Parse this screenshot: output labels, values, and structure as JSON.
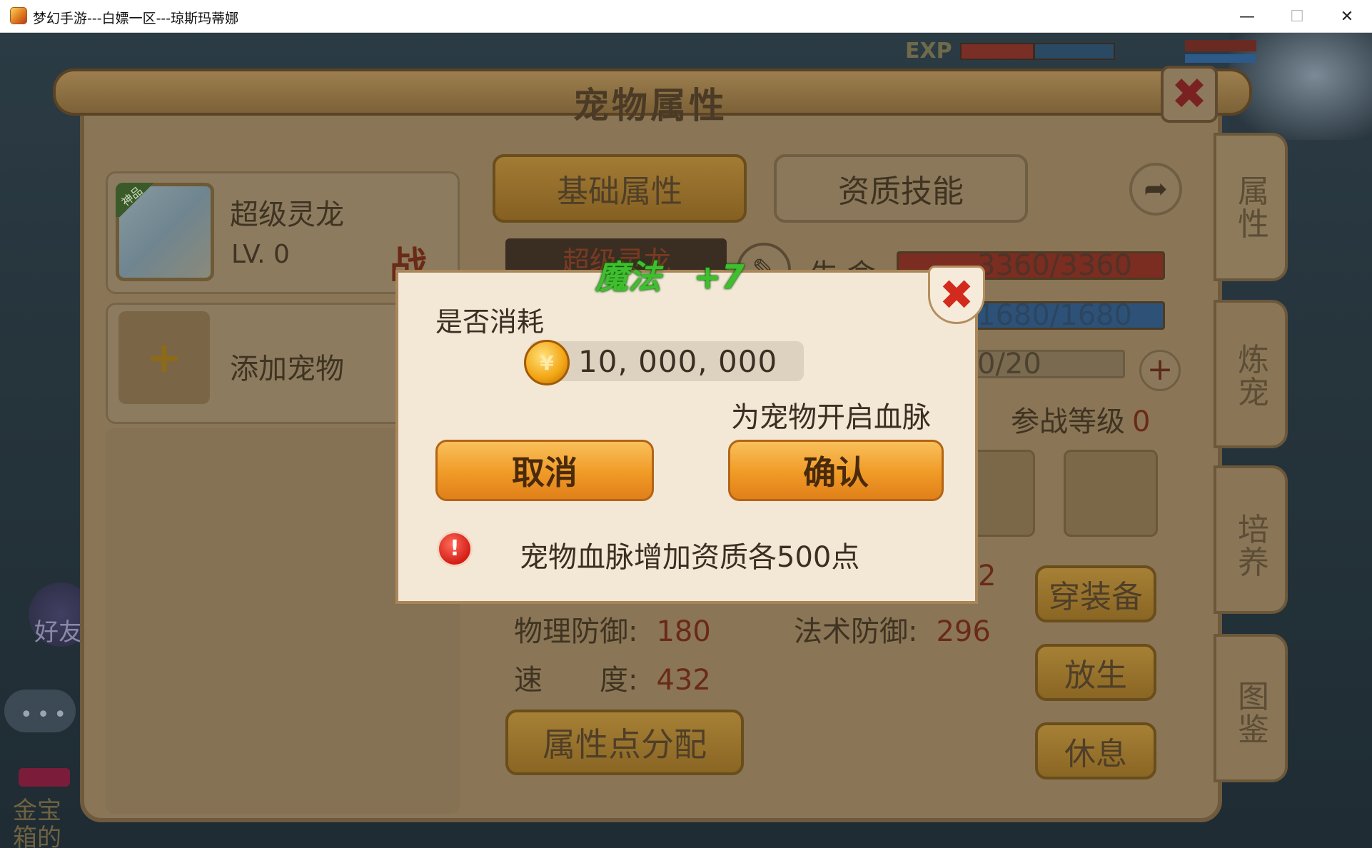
{
  "window": {
    "title": "梦幻手游---白嫖一区---琼斯玛蒂娜",
    "minimize": "—",
    "maximize": "☐",
    "close": "✕"
  },
  "hud": {
    "exp_label": "EXP"
  },
  "scene_left": {
    "friends_label": "好友",
    "chat_dots": "•••",
    "text_line1": "金宝",
    "text_line2": "箱的"
  },
  "panel": {
    "title": "宠物属性",
    "close_icon": "✖",
    "pet": {
      "badge": "神品",
      "name": "超级灵龙",
      "level": "LV. 0",
      "battle_mark": "战"
    },
    "add_pet": {
      "plus": "+",
      "label": "添加宠物"
    },
    "tabs": {
      "basic": "基础属性",
      "skills": "资质技能"
    },
    "share_icon": "➦",
    "name_bar": "超级灵龙",
    "edit_icon": "✎",
    "hp_label": "生 命",
    "hp": "3360/3360",
    "mp": "1680/1680",
    "exp": "0/20",
    "exp_plus": "+",
    "battle_level_label": "参战等级",
    "battle_level_value": "0",
    "hidden_digit": "2",
    "stats": {
      "phys_def_label": "物理防御:",
      "phys_def": "180",
      "mag_def_label": "法术防御:",
      "mag_def": "296",
      "speed_label": "速　　度:",
      "speed": "432"
    },
    "alloc_button": "属性点分配",
    "action_buttons": {
      "equip": "穿装备",
      "release": "放生",
      "rest": "休息"
    },
    "side_tabs": {
      "attributes": "属\n性",
      "refine": "炼\n宠",
      "train": "培\n养",
      "codex": "图\n鉴"
    }
  },
  "dialog": {
    "float_text": "魔法",
    "float_plus": "+7",
    "question": "是否消耗",
    "coin_icon": "¥",
    "amount": "10, 000, 000",
    "suffix": "为宠物开启血脉",
    "cancel": "取消",
    "confirm": "确认",
    "warn_icon": "!",
    "note": "宠物血脉增加资质各500点",
    "close_icon": "✖"
  }
}
